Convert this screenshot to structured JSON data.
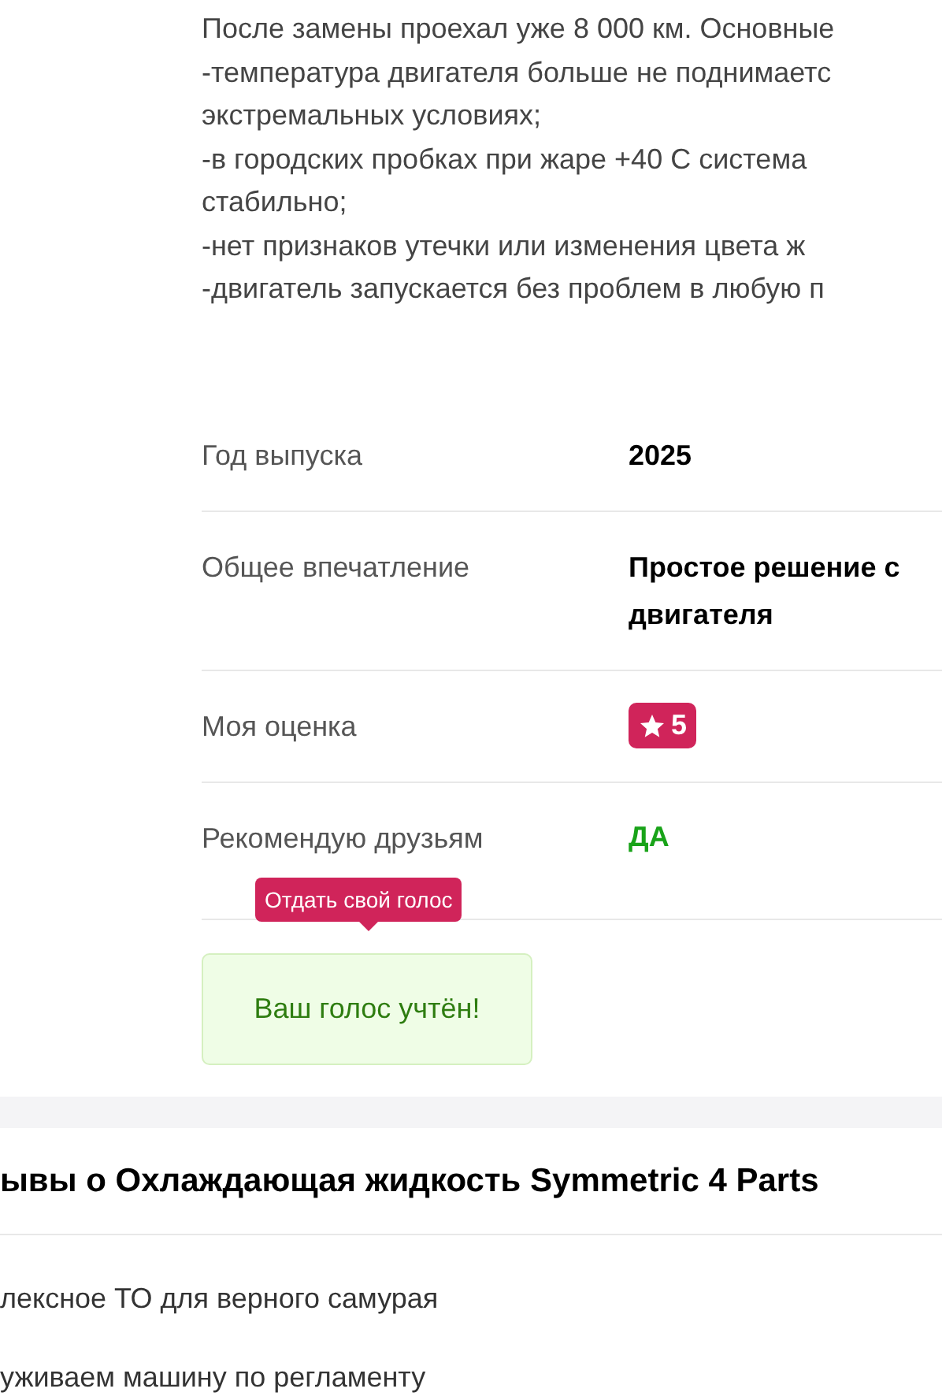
{
  "review_text": [
    "После замены проехал уже 8 000 км. Основные",
    "-температура двигателя больше не поднимаетс",
    "экстремальных условиях;",
    "-в городских пробках при жаре +40 С система",
    "стабильно;",
    "-нет признаков утечки или изменения цвета ж",
    "-двигатель запускается без проблем в любую п"
  ],
  "details": [
    {
      "kind": "text",
      "label": "Год выпуска",
      "value": "2025"
    },
    {
      "kind": "text",
      "label": "Общее впечатление",
      "value": "Простое решение с\nдвигателя"
    },
    {
      "kind": "rating",
      "label": "Моя оценка",
      "value": "5"
    },
    {
      "kind": "yes",
      "label": "Рекомендую друзьям",
      "value": "ДА"
    }
  ],
  "vote": {
    "tooltip": "Отдать свой голос",
    "message": "Ваш голос учтён!"
  },
  "related": {
    "title": "ывы о Охлаждающая жидкость Symmetric 4 Parts",
    "items": [
      "лексное ТО для верного самурая",
      "уживаем машину по регламенту"
    ]
  }
}
